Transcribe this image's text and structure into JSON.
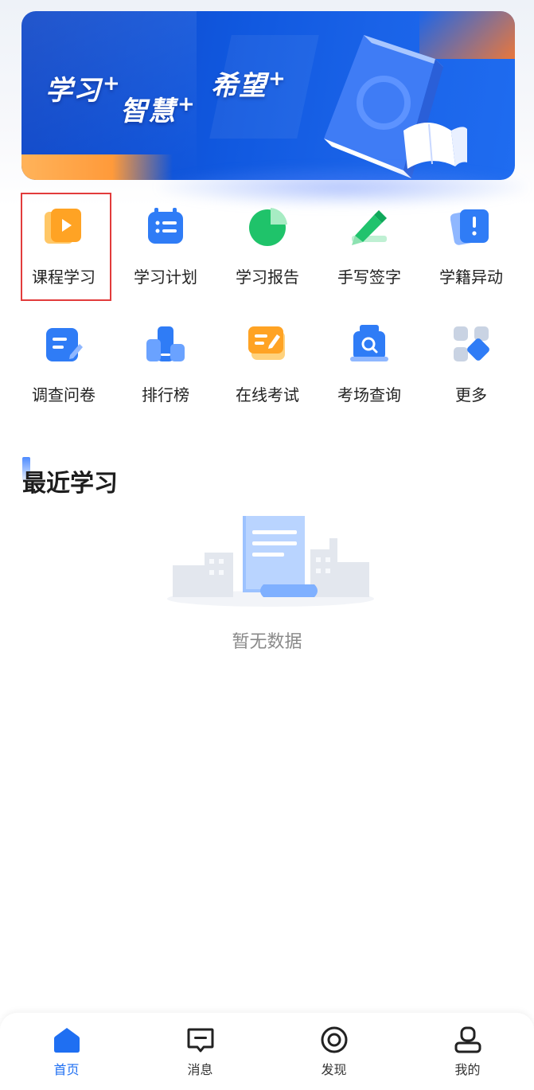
{
  "banner": {
    "slogans": [
      "学习",
      "智慧",
      "希望"
    ],
    "plus": "+"
  },
  "grid": {
    "items": [
      {
        "label": "课程学习",
        "icon": "course-video-icon"
      },
      {
        "label": "学习计划",
        "icon": "study-plan-icon"
      },
      {
        "label": "学习报告",
        "icon": "study-report-icon"
      },
      {
        "label": "手写签字",
        "icon": "handwriting-sign-icon"
      },
      {
        "label": "学籍异动",
        "icon": "status-change-icon"
      },
      {
        "label": "调查问卷",
        "icon": "survey-icon"
      },
      {
        "label": "排行榜",
        "icon": "ranking-icon"
      },
      {
        "label": "在线考试",
        "icon": "online-exam-icon"
      },
      {
        "label": "考场查询",
        "icon": "exam-room-query-icon"
      },
      {
        "label": "更多",
        "icon": "more-icon"
      }
    ]
  },
  "recent": {
    "title": "最近学习",
    "empty_text": "暂无数据"
  },
  "tabbar": {
    "items": [
      {
        "label": "首页",
        "icon": "home-icon",
        "active": true
      },
      {
        "label": "消息",
        "icon": "message-icon",
        "active": false
      },
      {
        "label": "发现",
        "icon": "discover-icon",
        "active": false
      },
      {
        "label": "我的",
        "icon": "profile-icon",
        "active": false
      }
    ]
  },
  "colors": {
    "accent": "#1f6ff2",
    "highlight_border": "#e23b3b",
    "banner_blue": "#1159e0",
    "text_muted": "#8a8a8a"
  }
}
